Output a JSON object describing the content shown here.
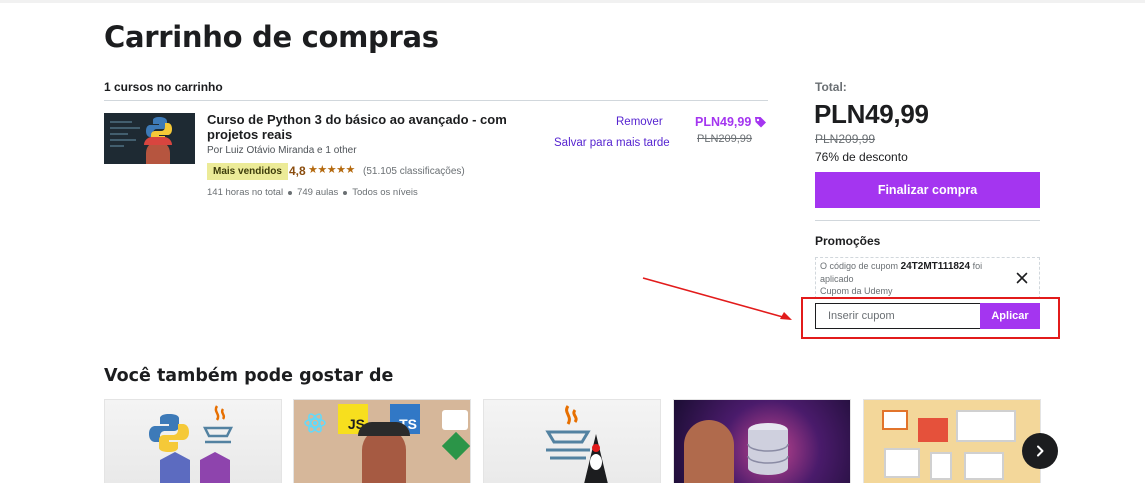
{
  "page": {
    "title": "Carrinho de compras"
  },
  "cart": {
    "count_label": "1 cursos no carrinho",
    "items": [
      {
        "title": "Curso de Python 3 do básico ao avançado - com projetos reais",
        "author": "Por Luiz Otávio Miranda e 1 other",
        "badge": "Mais vendidos",
        "rating": "4,8",
        "stars": "★★★★★",
        "rating_count": "(51.105 classificações)",
        "hours": "141 horas no total",
        "lectures": "749 aulas",
        "level": "Todos os níveis",
        "remove_label": "Remover",
        "save_label": "Salvar para mais tarde",
        "price": "PLN49,99",
        "original_price": "PLN209,99"
      }
    ]
  },
  "summary": {
    "total_label": "Total:",
    "total_price": "PLN49,99",
    "original_price": "PLN209,99",
    "discount": "76% de desconto",
    "checkout_label": "Finalizar compra"
  },
  "promotions": {
    "title": "Promoções",
    "applied_prefix": "O código de cupom",
    "applied_code": "24T2MT111824",
    "applied_suffix": "foi aplicado",
    "origin": "Cupom da Udemy",
    "input_placeholder": "Inserir cupom",
    "apply_label": "Aplicar"
  },
  "recommendations": {
    "title": "Você também pode gostar de",
    "cards": [
      {
        "icon": "python-java-c-icons"
      },
      {
        "icon": "js-ts-react-webpack-icons",
        "labels": [
          "JS",
          "TS"
        ]
      },
      {
        "icon": "java-duke-icon"
      },
      {
        "icon": "database-icon"
      },
      {
        "icon": "web-design-icons"
      }
    ]
  },
  "colors": {
    "accent": "#a435f0",
    "link": "#5624d0",
    "annotation": "#e21b1b",
    "badge_bg": "#eceb98",
    "star": "#b4690e"
  }
}
